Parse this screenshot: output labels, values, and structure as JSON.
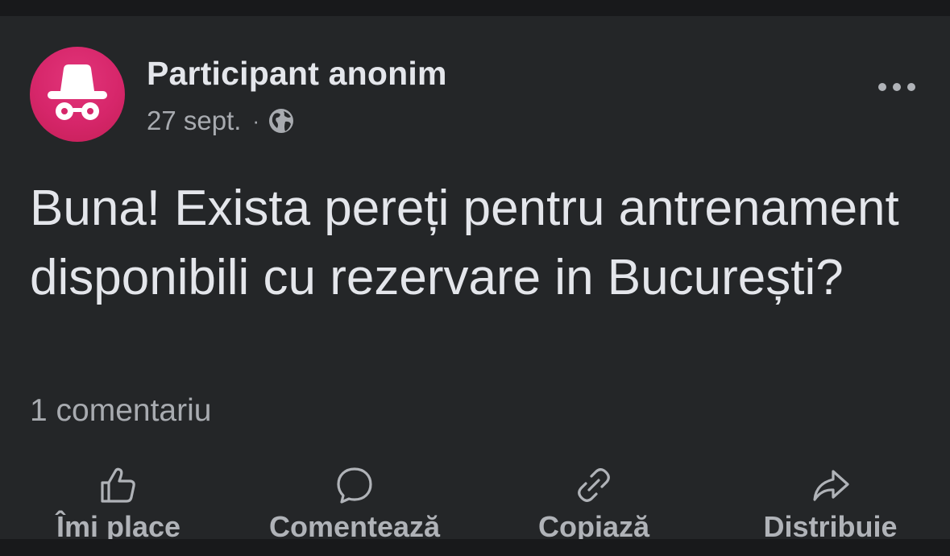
{
  "post": {
    "author": "Participant anonim",
    "date": "27 sept.",
    "separator": "·",
    "audience_icon": "globe-icon",
    "avatar_icon": "incognito-icon",
    "text": "Buna! Exista pereți pentru antrenament disponibili cu rezervare in București?",
    "comments_count": "1 comentariu"
  },
  "menu": {
    "icon": "more-options-icon"
  },
  "actions": [
    {
      "label": "Îmi place",
      "icon": "thumbs-up-icon"
    },
    {
      "label": "Comentează",
      "icon": "comment-bubble-icon"
    },
    {
      "label": "Copiază",
      "icon": "link-icon"
    },
    {
      "label": "Distribuie",
      "icon": "share-arrow-icon"
    }
  ],
  "colors": {
    "background": "#18191b",
    "card": "#242628",
    "primary_text": "#e4e6eb",
    "secondary_text": "#a8abb0",
    "avatar": "#d6266a"
  }
}
